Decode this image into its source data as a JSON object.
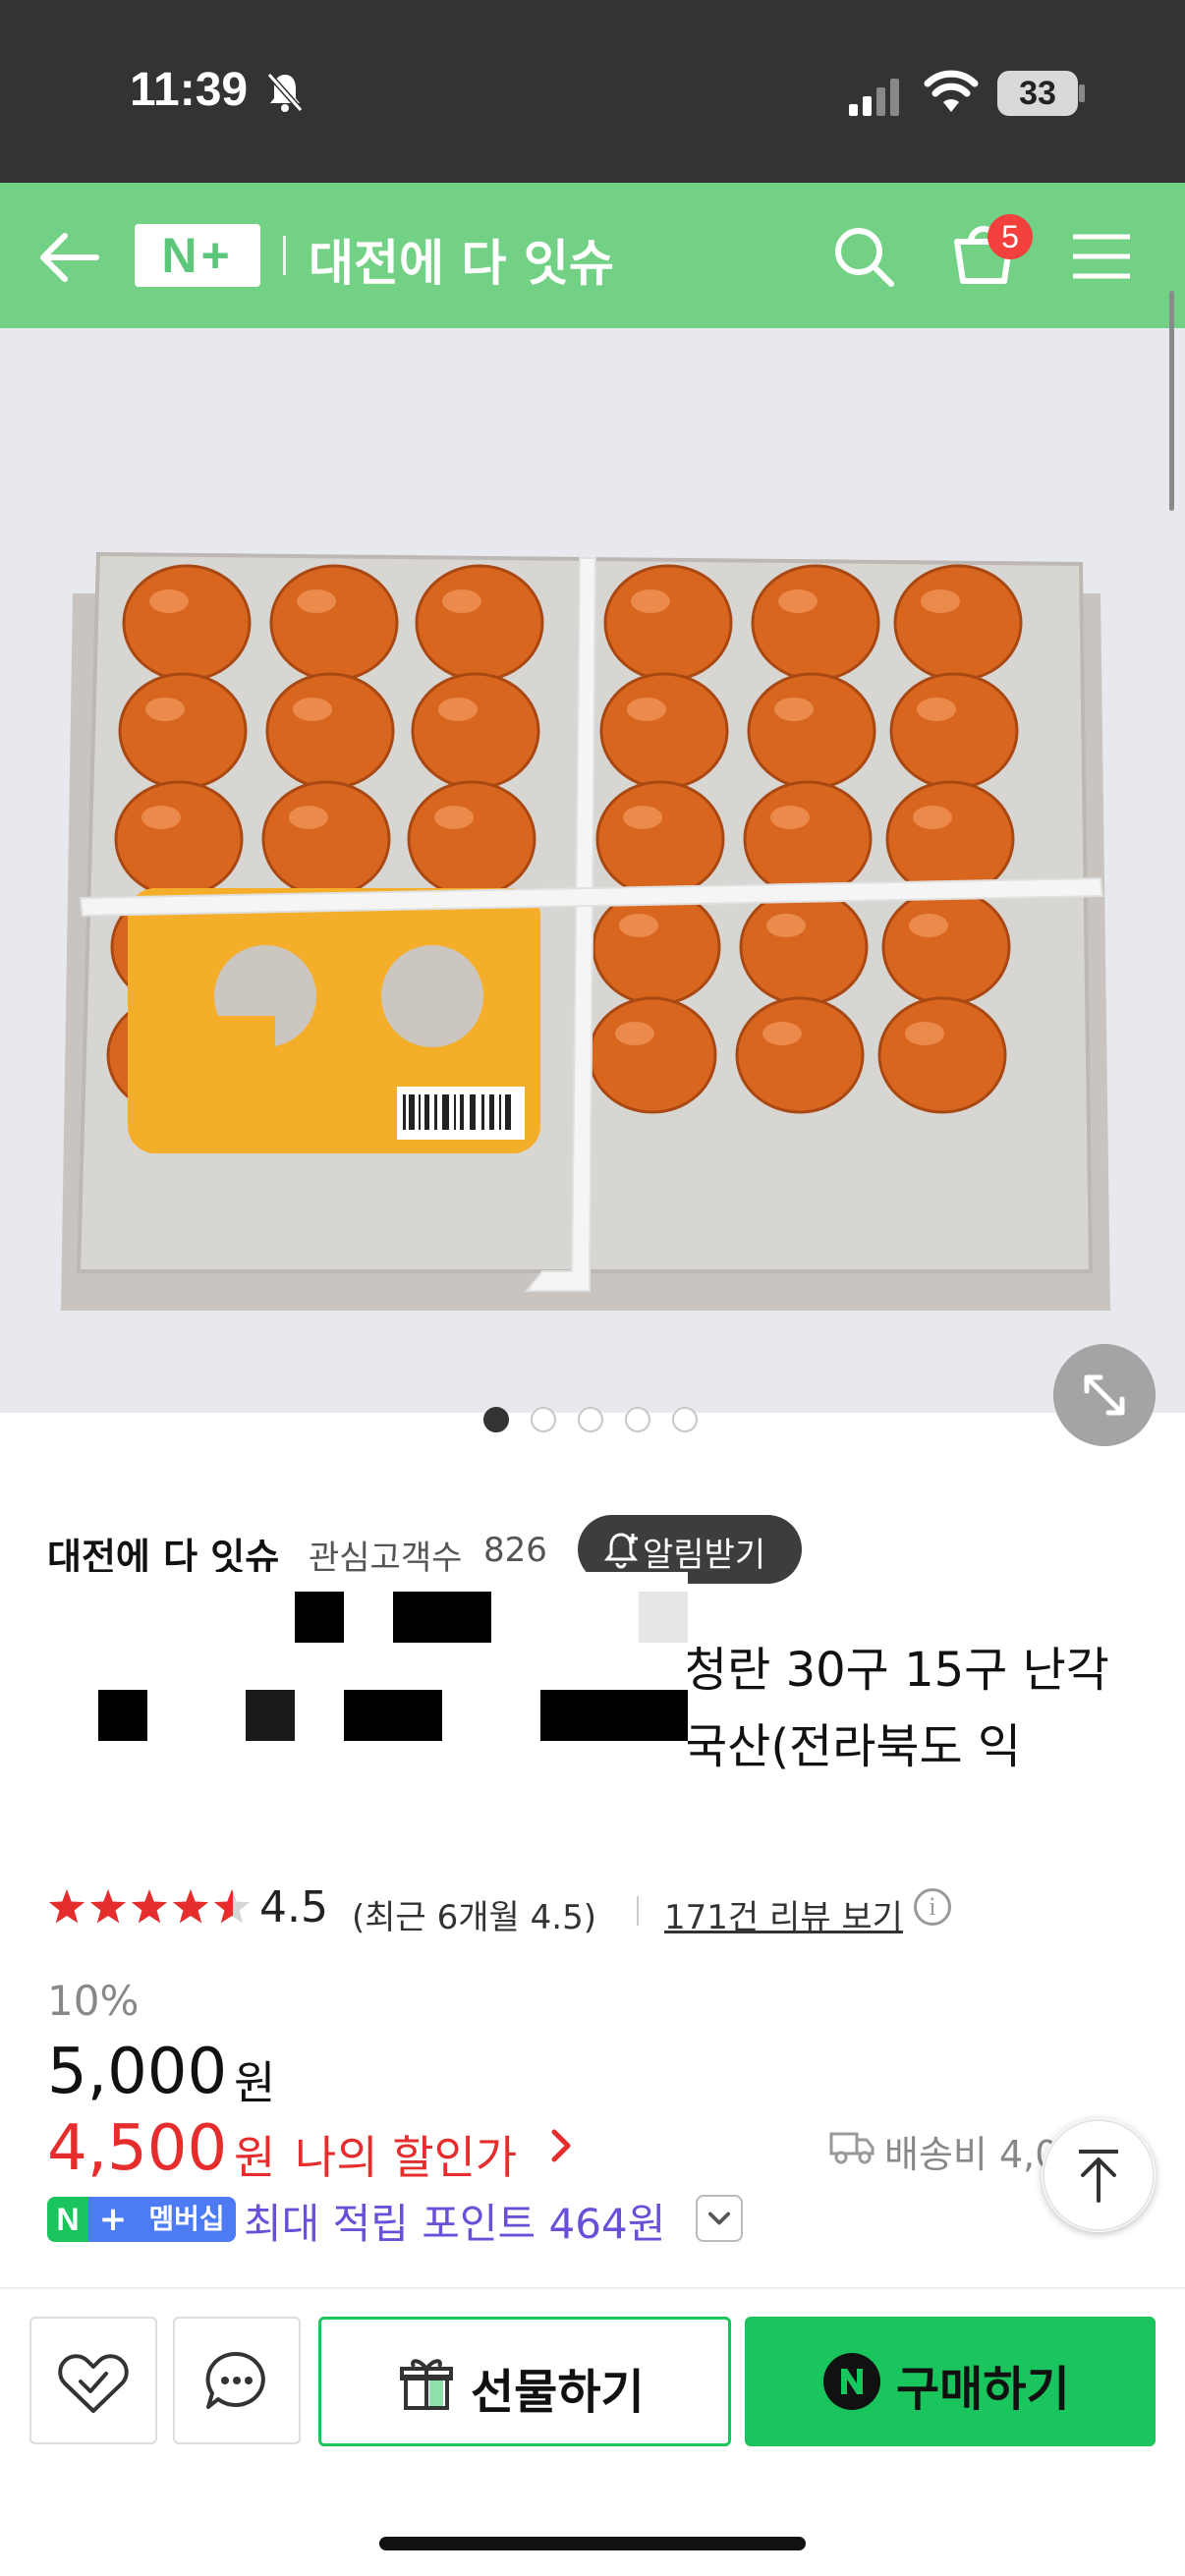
{
  "status_bar": {
    "time": "11:39",
    "battery": "33"
  },
  "header": {
    "logo": "N+",
    "title": "대전에 다 잇슈",
    "cart_count": "5",
    "bg_color": "#73d185"
  },
  "gallery": {
    "dot_count": 5,
    "active_index": 0
  },
  "seller": {
    "name": "대전에 다 잇슈",
    "follower_label": "관심고객수",
    "follower_count": "826",
    "alert_button": "알림받기"
  },
  "product": {
    "title_line1": "청란 30구 15구 난각",
    "title_line2": "국산(전라북도 익"
  },
  "rating": {
    "stars": 4.5,
    "value": "4.5",
    "recent": "(최근 6개월 4.5)",
    "review_link": "171건 리뷰 보기"
  },
  "price": {
    "discount_rate": "10%",
    "original": "5,000",
    "won": "원",
    "sale": "4,500",
    "my_discount_label": "나의 할인가",
    "delivery": "배송비 4,000원",
    "sale_color": "#e52d2d"
  },
  "membership": {
    "badge_n": "N",
    "badge_plus": "+",
    "badge_label": "멤버십",
    "points_text": "최대 적립 포인트 464원"
  },
  "bottom_bar": {
    "gift_label": "선물하기",
    "buy_label": "구매하기",
    "buy_color": "#19c55c"
  }
}
